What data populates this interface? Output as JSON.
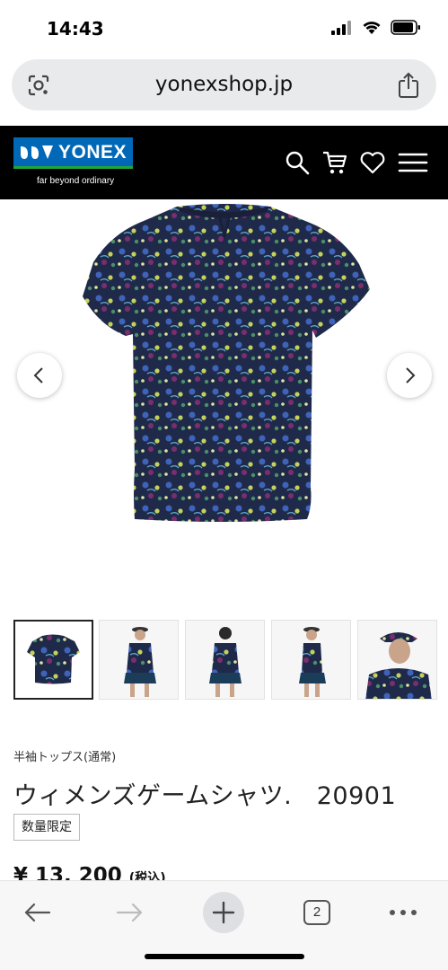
{
  "status_bar": {
    "time": "14:43"
  },
  "browser": {
    "url": "yonexshop.jp",
    "tab_count": "2"
  },
  "site": {
    "brand": "YONEX",
    "tagline": "far beyond ordinary"
  },
  "product": {
    "category": "半袖トップス(通常)",
    "title": "ウィメンズゲームシャツ.　20901",
    "badge": "数量限定",
    "price": "¥ 13, 200",
    "price_tax": "(税込)"
  },
  "thumbnails": [
    {
      "name": "thumb-shirt-front",
      "selected": true
    },
    {
      "name": "thumb-model-front",
      "selected": false
    },
    {
      "name": "thumb-model-back",
      "selected": false
    },
    {
      "name": "thumb-model-side",
      "selected": false
    },
    {
      "name": "thumb-model-closeup",
      "selected": false
    }
  ],
  "colors": {
    "header_bg": "#000000",
    "logo_blue": "#0068b7",
    "logo_green": "#22a538",
    "url_bar_bg": "#e9eaec"
  },
  "icons": {
    "status": [
      "cellular-signal-icon",
      "wifi-icon",
      "battery-icon"
    ],
    "header": [
      "search-icon",
      "cart-icon",
      "heart-icon",
      "menu-icon"
    ],
    "toolbar": [
      "back-arrow-icon",
      "forward-arrow-icon",
      "new-tab-icon",
      "tab-switcher-icon",
      "more-icon"
    ]
  }
}
